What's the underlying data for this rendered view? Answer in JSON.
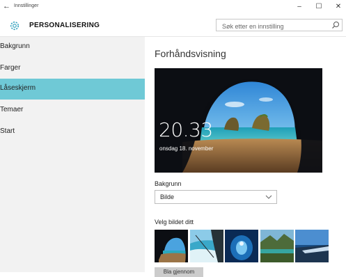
{
  "window": {
    "back_glyph": "←",
    "title": "Innstillinger",
    "minimize_glyph": "–",
    "maximize_glyph": "☐",
    "close_glyph": "✕"
  },
  "header": {
    "icon": "gear-icon",
    "title": "PERSONALISERING",
    "search_placeholder": "Søk etter en innstilling",
    "search_icon": "search-icon"
  },
  "sidebar": {
    "items": [
      {
        "label": "Bakgrunn",
        "active": false
      },
      {
        "label": "Farger",
        "active": false
      },
      {
        "label": "Låseskjerm",
        "active": true
      },
      {
        "label": "Temaer",
        "active": false
      },
      {
        "label": "Start",
        "active": false
      }
    ]
  },
  "main": {
    "preview_title": "Forhåndsvisning",
    "preview_time": "20.33",
    "preview_date": "onsdag 18. november",
    "background_label": "Bakgrunn",
    "background_value": "Bilde",
    "choose_label": "Velg bildet ditt",
    "browse_button": "Bla gjennom"
  },
  "colors": {
    "accent": "#6fc9d6",
    "sidebar_bg": "#f2f2f2",
    "button_bg": "#cccccc"
  }
}
